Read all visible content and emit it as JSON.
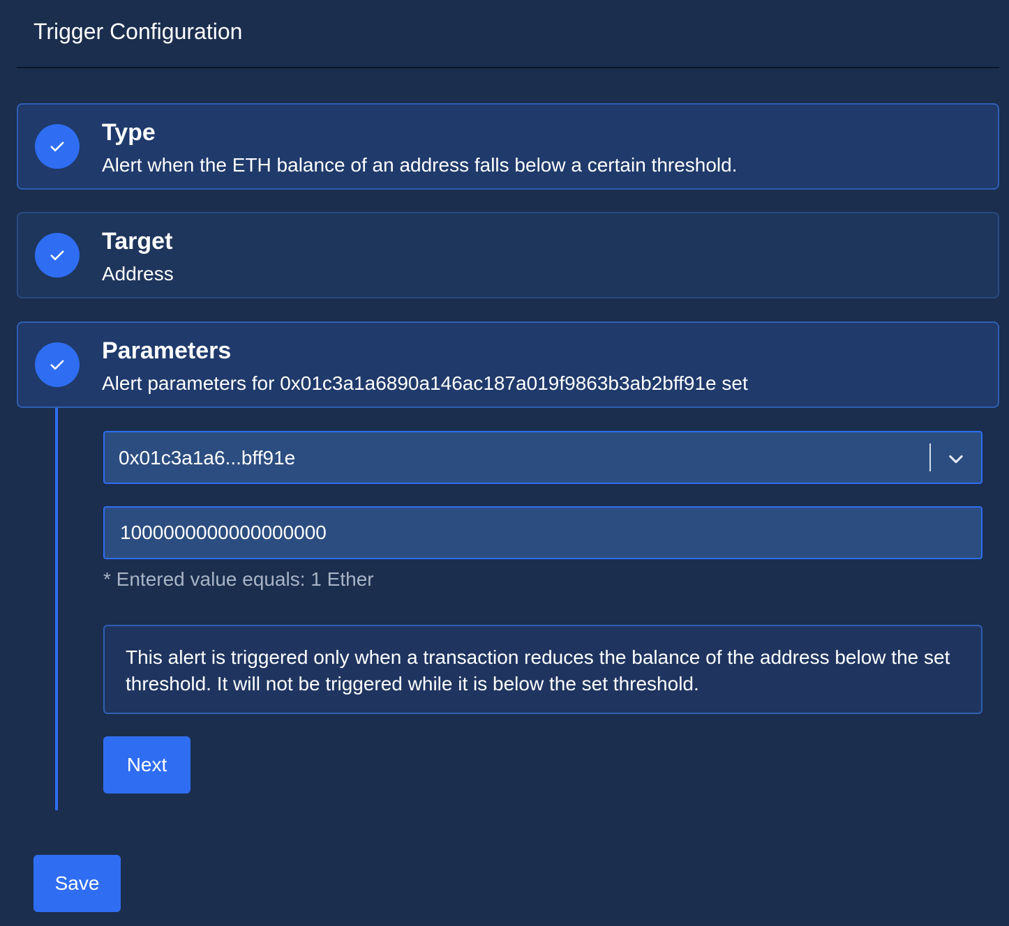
{
  "header": {
    "title": "Trigger Configuration"
  },
  "steps": [
    {
      "title": "Type",
      "description": "Alert when the ETH balance of an address falls below a certain threshold.",
      "status": "completed"
    },
    {
      "title": "Target",
      "description": "Address",
      "status": "completed"
    },
    {
      "title": "Parameters",
      "description": "Alert parameters for 0x01c3a1a6890a146ac187a019f9863b3ab2bff91e set",
      "status": "completed"
    }
  ],
  "parameters": {
    "address_select": {
      "selected": "0x01c3a1a6...bff91e"
    },
    "threshold_input": {
      "value": "1000000000000000000"
    },
    "helper_text": "* Entered value equals: 1 Ether",
    "info_text": "This alert is triggered only when a transaction reduces the balance of the address below the set threshold. It will not be triggered while it is below the set threshold.",
    "next_label": "Next"
  },
  "footer": {
    "save_label": "Save"
  },
  "icons": {
    "step_check": "check-icon",
    "select_toggle": "chevron-down-icon"
  },
  "colors": {
    "background": "#1b2e4e",
    "accent": "#2f6ef2",
    "step_bg": "#1f3a6b",
    "input_bg": "#2c4d80",
    "muted_text": "#a9b4c6"
  }
}
